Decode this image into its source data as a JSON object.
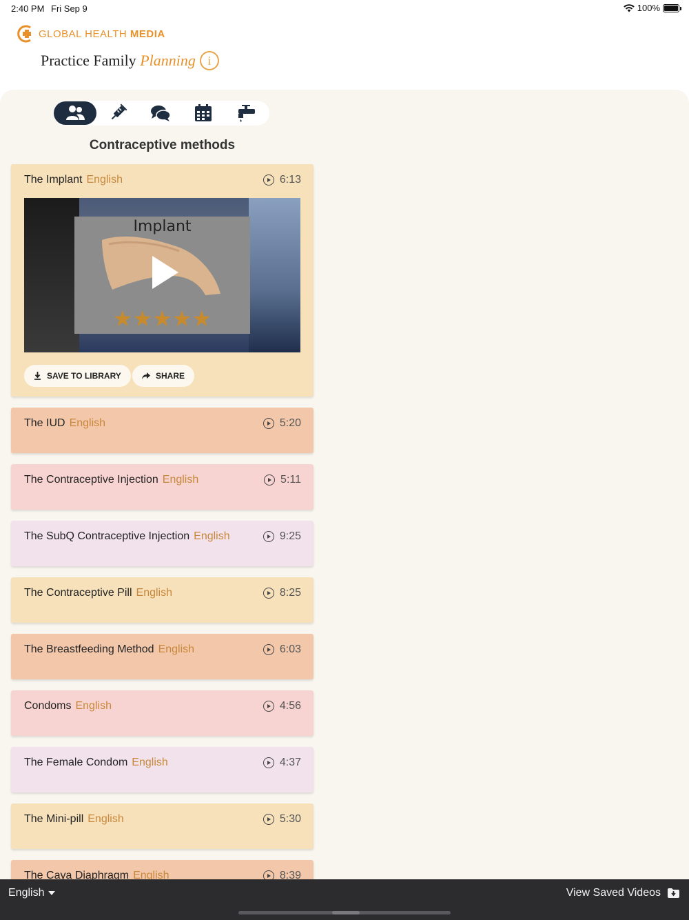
{
  "status": {
    "time": "2:40 PM",
    "date": "Fri Sep 9",
    "battery": "100%",
    "battery_level": 1.0
  },
  "brand": {
    "name_regular": "GLOBAL HEALTH ",
    "name_bold": "MEDIA",
    "app_title_main": "Practice Family ",
    "app_title_accent": "Planning",
    "info_glyph": "i"
  },
  "tabs": [
    {
      "name": "people-icon",
      "active": true
    },
    {
      "name": "syringe-icon",
      "active": false
    },
    {
      "name": "chat-bubbles-icon",
      "active": false
    },
    {
      "name": "calendar-icon",
      "active": false
    },
    {
      "name": "faucet-icon",
      "active": false
    }
  ],
  "section_title": "Contraceptive methods",
  "videos": [
    {
      "title": "The Implant",
      "lang": "English",
      "duration": "6:13",
      "color": "#f7e1bb",
      "expanded": true
    },
    {
      "title": "The IUD",
      "lang": "English",
      "duration": "5:20",
      "color": "#f2c7aa",
      "expanded": false
    },
    {
      "title": "The Contraceptive Injection",
      "lang": "English",
      "duration": "5:11",
      "color": "#f7d4d1",
      "expanded": false
    },
    {
      "title": "The SubQ Contraceptive Injection",
      "lang": "English",
      "duration": "9:25",
      "color": "#f2e2ec",
      "expanded": false
    },
    {
      "title": "The Contraceptive Pill",
      "lang": "English",
      "duration": "8:25",
      "color": "#f7e1bb",
      "expanded": false
    },
    {
      "title": "The Breastfeeding Method",
      "lang": "English",
      "duration": "6:03",
      "color": "#f2c7aa",
      "expanded": false
    },
    {
      "title": "Condoms",
      "lang": "English",
      "duration": "4:56",
      "color": "#f7d4d1",
      "expanded": false
    },
    {
      "title": "The Female Condom",
      "lang": "English",
      "duration": "4:37",
      "color": "#f2e2ec",
      "expanded": false
    },
    {
      "title": "The Mini-pill",
      "lang": "English",
      "duration": "5:30",
      "color": "#f7e1bb",
      "expanded": false
    },
    {
      "title": "The Caya Diaphragm",
      "lang": "English",
      "duration": "8:39",
      "color": "#f2c7aa",
      "expanded": false
    }
  ],
  "player": {
    "thumbnail_label": "Implant",
    "star_glyphs": "★★★★★",
    "save_label": "SAVE TO LIBRARY",
    "share_label": "SHARE"
  },
  "bottom": {
    "language": "English",
    "saved_videos": "View Saved Videos"
  },
  "colors": {
    "accent": "#e8912a",
    "navy": "#1e2d40",
    "lang_text": "#c8873a",
    "background": "#f9f6ef",
    "bottom_bar": "#2c2c2e"
  }
}
